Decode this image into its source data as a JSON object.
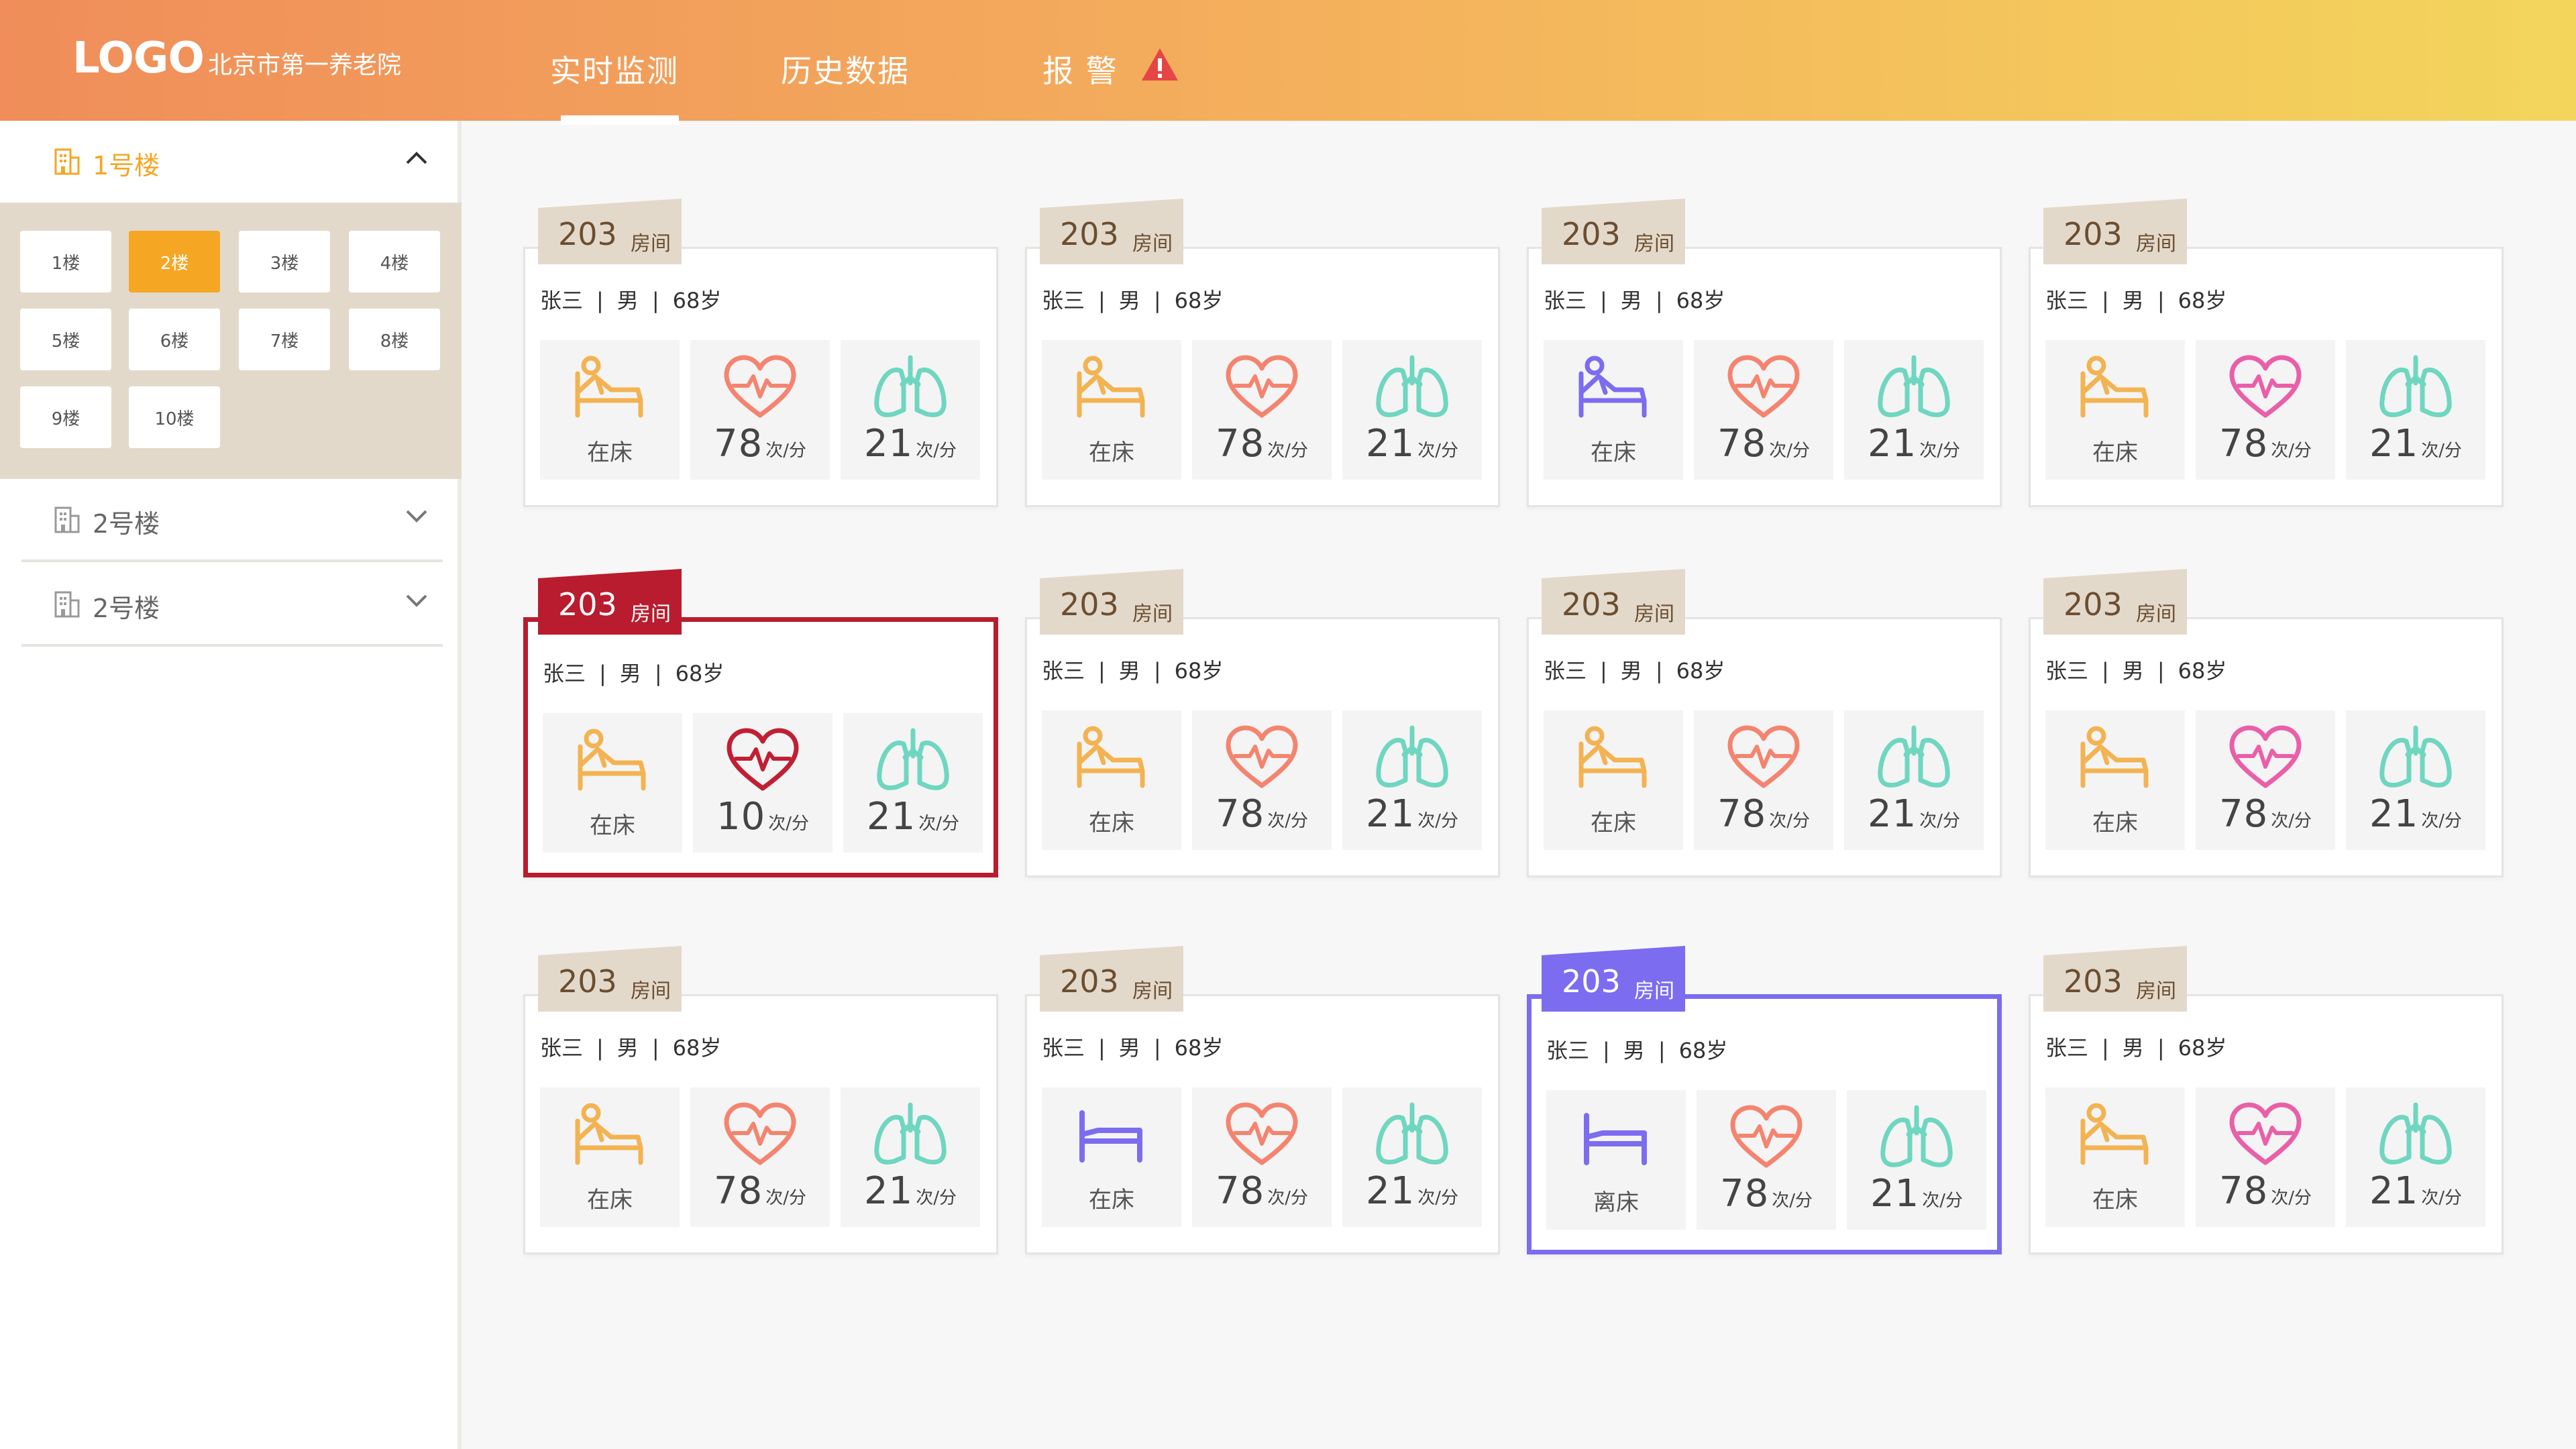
{
  "header": {
    "logo": "LOGO",
    "org": "北京市第一养老院",
    "nav": [
      {
        "label": "实时监测",
        "active": true
      },
      {
        "label": "历史数据",
        "active": false
      },
      {
        "label": "报 警",
        "active": false
      }
    ]
  },
  "sidebar": {
    "buildings": [
      {
        "label": "1号楼",
        "expanded": true,
        "accent": "#f5a623"
      },
      {
        "label": "2号楼",
        "expanded": false
      },
      {
        "label": "2号楼",
        "expanded": false
      }
    ],
    "floors": [
      "1楼",
      "2楼",
      "3楼",
      "4楼",
      "5楼",
      "6楼",
      "7楼",
      "8楼",
      "9楼",
      "10楼"
    ],
    "active_floor": "2楼"
  },
  "colors": {
    "accent": "#f5a623",
    "alert": "#b81c2e",
    "leave": "#7b6cf0",
    "tab_default": "#e3d9cb",
    "heart_default": "#f4846f",
    "heart_pink": "#e95fa8",
    "heart_alert": "#c01f34",
    "lung": "#6fd6c0",
    "bed_default": "#f3b352",
    "bed_purple": "#7b6cf0"
  },
  "units": {
    "room": "房间",
    "rate": "次/分"
  },
  "rooms": [
    {
      "room": "203",
      "name": "张三",
      "gender": "男",
      "age": "68岁",
      "bed_status": "在床",
      "heart_rate": "78",
      "breath_rate": "21",
      "state": "normal",
      "bed_icon": "in-bed",
      "bed_color": "orange",
      "heart_color": "coral"
    },
    {
      "room": "203",
      "name": "张三",
      "gender": "男",
      "age": "68岁",
      "bed_status": "在床",
      "heart_rate": "78",
      "breath_rate": "21",
      "state": "normal",
      "bed_icon": "in-bed",
      "bed_color": "orange",
      "heart_color": "coral"
    },
    {
      "room": "203",
      "name": "张三",
      "gender": "男",
      "age": "68岁",
      "bed_status": "在床",
      "heart_rate": "78",
      "breath_rate": "21",
      "state": "normal",
      "bed_icon": "in-bed",
      "bed_color": "purple",
      "heart_color": "coral"
    },
    {
      "room": "203",
      "name": "张三",
      "gender": "男",
      "age": "68岁",
      "bed_status": "在床",
      "heart_rate": "78",
      "breath_rate": "21",
      "state": "normal",
      "bed_icon": "in-bed",
      "bed_color": "orange",
      "heart_color": "pink"
    },
    {
      "room": "203",
      "name": "张三",
      "gender": "男",
      "age": "68岁",
      "bed_status": "在床",
      "heart_rate": "10",
      "breath_rate": "21",
      "state": "alert",
      "bed_icon": "in-bed",
      "bed_color": "orange",
      "heart_color": "red"
    },
    {
      "room": "203",
      "name": "张三",
      "gender": "男",
      "age": "68岁",
      "bed_status": "在床",
      "heart_rate": "78",
      "breath_rate": "21",
      "state": "normal",
      "bed_icon": "in-bed",
      "bed_color": "orange",
      "heart_color": "coral"
    },
    {
      "room": "203",
      "name": "张三",
      "gender": "男",
      "age": "68岁",
      "bed_status": "在床",
      "heart_rate": "78",
      "breath_rate": "21",
      "state": "normal",
      "bed_icon": "in-bed",
      "bed_color": "orange",
      "heart_color": "coral"
    },
    {
      "room": "203",
      "name": "张三",
      "gender": "男",
      "age": "68岁",
      "bed_status": "在床",
      "heart_rate": "78",
      "breath_rate": "21",
      "state": "normal",
      "bed_icon": "in-bed",
      "bed_color": "orange",
      "heart_color": "pink"
    },
    {
      "room": "203",
      "name": "张三",
      "gender": "男",
      "age": "68岁",
      "bed_status": "在床",
      "heart_rate": "78",
      "breath_rate": "21",
      "state": "normal",
      "bed_icon": "in-bed",
      "bed_color": "orange",
      "heart_color": "coral"
    },
    {
      "room": "203",
      "name": "张三",
      "gender": "男",
      "age": "68岁",
      "bed_status": "在床",
      "heart_rate": "78",
      "breath_rate": "21",
      "state": "normal",
      "bed_icon": "empty-bed",
      "bed_color": "purple",
      "heart_color": "coral"
    },
    {
      "room": "203",
      "name": "张三",
      "gender": "男",
      "age": "68岁",
      "bed_status": "离床",
      "heart_rate": "78",
      "breath_rate": "21",
      "state": "leave",
      "bed_icon": "empty-bed",
      "bed_color": "purple",
      "heart_color": "coral"
    },
    {
      "room": "203",
      "name": "张三",
      "gender": "男",
      "age": "68岁",
      "bed_status": "在床",
      "heart_rate": "78",
      "breath_rate": "21",
      "state": "normal",
      "bed_icon": "in-bed",
      "bed_color": "orange",
      "heart_color": "pink"
    }
  ]
}
